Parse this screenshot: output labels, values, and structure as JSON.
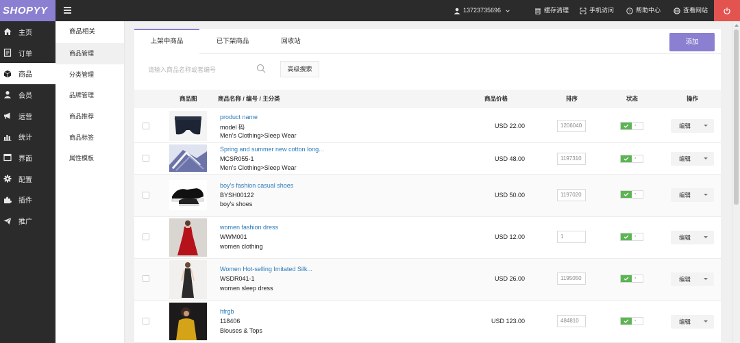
{
  "app": {
    "logo": "SHOPYY"
  },
  "topbar": {
    "user": "13723735696",
    "clear_cache": "缓存清理",
    "mobile": "手机访问",
    "help": "帮助中心",
    "view_site": "查看网站"
  },
  "leftnav": {
    "items": [
      {
        "label": "主页",
        "icon": "home-icon"
      },
      {
        "label": "订单",
        "icon": "order-icon"
      },
      {
        "label": "商品",
        "icon": "box-icon"
      },
      {
        "label": "会员",
        "icon": "user-icon"
      },
      {
        "label": "运营",
        "icon": "megaphone-icon"
      },
      {
        "label": "统计",
        "icon": "bar-chart-icon"
      },
      {
        "label": "界面",
        "icon": "window-icon"
      },
      {
        "label": "配置",
        "icon": "gear-icon"
      },
      {
        "label": "插件",
        "icon": "puzzle-icon"
      },
      {
        "label": "推广",
        "icon": "paper-plane-icon"
      }
    ]
  },
  "subnav": {
    "title": "商品相关",
    "items": [
      "商品管理",
      "分类管理",
      "品牌管理",
      "商品推荐",
      "商品标签",
      "属性模板"
    ]
  },
  "tabs": [
    "上架中商品",
    "已下架商品",
    "回收站"
  ],
  "add_button": "添加",
  "search": {
    "placeholder": "请输入商品名称或者编号",
    "advanced": "高级搜索"
  },
  "table": {
    "headers": {
      "image": "商品图",
      "name": "商品名称 / 编号 / 主分类",
      "price": "商品价格",
      "sort": "排序",
      "status": "状态",
      "action": "操作"
    },
    "edit_label": "编辑",
    "rows": [
      {
        "name": "product name",
        "code": "model 码",
        "category": "Men’s Clothing>Sleep Wear",
        "price": "USD 22.00",
        "sort": "1206040",
        "status_on": true
      },
      {
        "name": "Spring and summer new cotton long...",
        "code": "MCSR055-1",
        "category": "Men’s Clothing>Sleep Wear",
        "price": "USD 48.00",
        "sort": "1197310",
        "status_on": true
      },
      {
        "name": "boy's fashion casual shoes",
        "code": "BYSH00122",
        "category": "boy's shoes",
        "price": "USD 50.00",
        "sort": "1197020",
        "status_on": true
      },
      {
        "name": "women fashion dress",
        "code": "WWM001",
        "category": "women clothing",
        "price": "USD 12.00",
        "sort": "1",
        "status_on": true
      },
      {
        "name": "Women Hot-selling Imitated Silk...",
        "code": "WSDR041-1",
        "category": "women sleep dress",
        "price": "USD 26.00",
        "sort": "1195050",
        "status_on": true
      },
      {
        "name": "hfrgb",
        "code": "118406",
        "category": "Blouses & Tops",
        "price": "USD 123.00",
        "sort": "484810",
        "status_on": true
      }
    ]
  },
  "colors": {
    "accent": "#8a7fd0",
    "link": "#2a7ab9",
    "toggle_on": "#5ab552",
    "power": "#e35451",
    "dark": "#2b2b2b"
  }
}
